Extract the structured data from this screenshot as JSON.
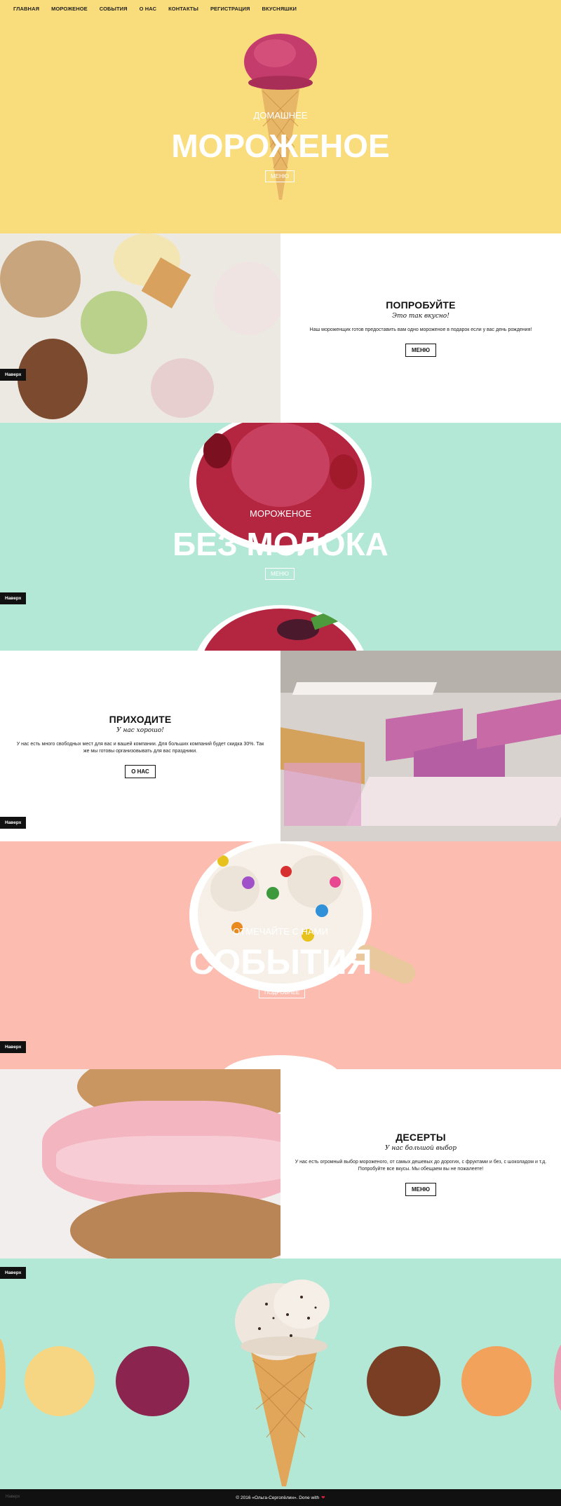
{
  "nav": [
    "ГЛАВНАЯ",
    "МОРОЖЕНОЕ",
    "СОБЫТИЯ",
    "О НАС",
    "КОНТАКТЫ",
    "РЕГИСТРАЦИЯ",
    "ВКУСНЯШКИ"
  ],
  "hero": {
    "pre": "ДОМАШНЕЕ",
    "title": "МОРОЖЕНОЕ",
    "button": "МЕНЮ"
  },
  "try": {
    "title": "ПОПРОБУЙТЕ",
    "sub": "Это так вкусно!",
    "text": "Наш мороженщик готов предоставить вам одно мороженое в подарок если у вас день рождения!",
    "button": "МЕНЮ"
  },
  "milk": {
    "pre": "МОРОЖЕНОЕ",
    "title": "БЕЗ МОЛОКА",
    "button": "МЕНЮ"
  },
  "come": {
    "title": "ПРИХОДИТЕ",
    "sub": "У нас хорошо!",
    "text": "У нас есть много свободных мест для вас и вашей компании. Для больших компаний будет скидка 30%. Так же мы готовы организовывать для вас праздники.",
    "button": "О НАС"
  },
  "events": {
    "pre": "ОТМЕЧАЙТЕ С НАМИ",
    "title": "СОБЫТИЯ",
    "button": "ПОДРОБНЕЕ"
  },
  "desserts": {
    "title": "ДЕСЕРТЫ",
    "sub": "У нас большой выбор",
    "text": "У нас есть огромный выбор мороженого, от самых дешевых до дорогих, с фруктами и без, с шоколадом и т.д. Попробуйте все вкусы. Мы обещаем вы не пожалеете!",
    "button": "МЕНЮ"
  },
  "top_label": "Наверх",
  "footer": {
    "text": "© 2016 «Ольга-Сергопёлин». Done with",
    "heart": "❤"
  },
  "colors": {
    "yellow": "#f9dc7c",
    "mint": "#b3e8d6",
    "pink": "#fdbcb0",
    "dark": "#111111"
  }
}
